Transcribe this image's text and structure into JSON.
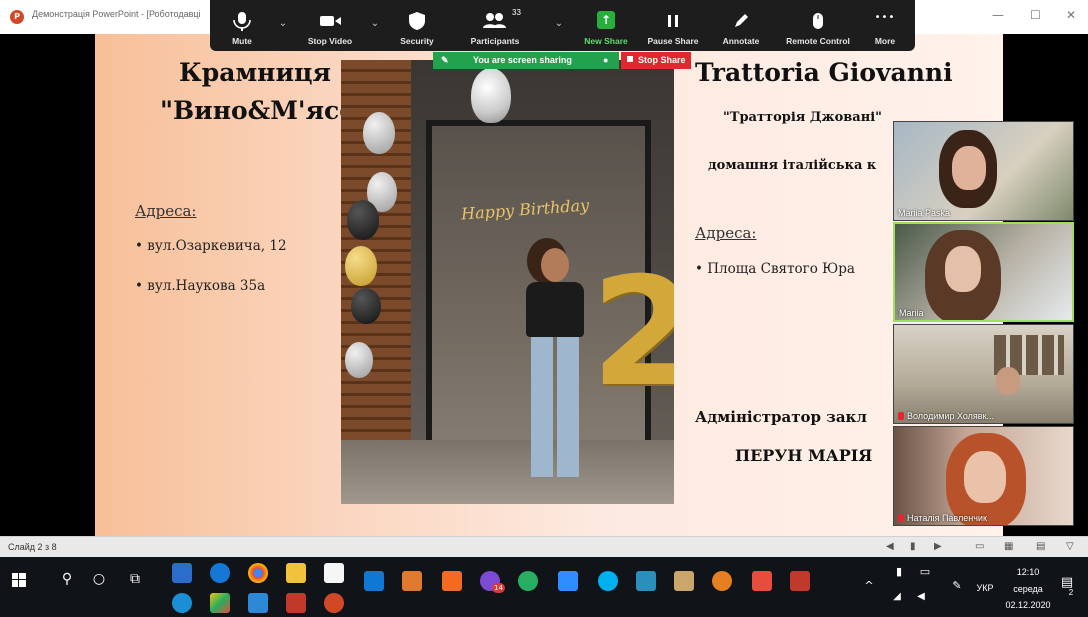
{
  "window": {
    "title": "Демонстрація PowerPoint - [Роботодавці",
    "minimize": "—",
    "restore": "☐",
    "close": "✕"
  },
  "zoom_toolbar": {
    "items": [
      {
        "label": "Mute",
        "icon": "microphone-icon"
      },
      {
        "label": "Stop Video",
        "icon": "video-camera-icon"
      },
      {
        "label": "Security",
        "icon": "shield-icon"
      },
      {
        "label": "Participants",
        "icon": "participants-icon",
        "count": "33"
      },
      {
        "label": "New Share",
        "icon": "share-arrow-icon"
      },
      {
        "label": "Pause Share",
        "icon": "pause-icon"
      },
      {
        "label": "Annotate",
        "icon": "pencil-icon"
      },
      {
        "label": "Remote Control",
        "icon": "mouse-icon"
      },
      {
        "label": "More",
        "icon": "ellipsis-icon"
      }
    ],
    "more_glyph": "•••",
    "caret": "⌄",
    "sharing_text": "You are screen sharing",
    "stop_share": "Stop Share"
  },
  "slide": {
    "left_title": "Крамниця \"Вино&М'ясо\"",
    "left_address_label": "Адреса:",
    "left_bullets": [
      "• вул.Озаркевича, 12",
      "• вул.Наукова 35а"
    ],
    "right_title": "Trattoria Giovanni",
    "right_sub1": "\"Тратторія Джовані\"",
    "right_sub2": "домашня італійська к",
    "right_address_label": "Адреса:",
    "right_bullets": [
      "• Площа Святого Юра"
    ],
    "admin_label": "Адміністратор закл",
    "admin_name": "ПЕРУН МАРІЯ",
    "banner": "Happy Birthday"
  },
  "video_tiles": [
    {
      "name": "Mariia Paska",
      "muted": false
    },
    {
      "name": "Mariia",
      "muted": false
    },
    {
      "name": "Володимир Холявк...",
      "muted": true
    },
    {
      "name": "Наталія Павленчик",
      "muted": true
    }
  ],
  "status_bar": {
    "slide_counter": "Слайд 2 з 8"
  },
  "taskbar": {
    "messenger_badge": "14",
    "language": "УКР",
    "time": "12:10",
    "day": "середа",
    "date": "02.12.2020",
    "notifications": "2"
  },
  "colors": {
    "zoom_bg": "#1d1d1d",
    "share_green": "#23a24d",
    "stop_red": "#e0282e",
    "taskbar_bg": "#101418"
  }
}
